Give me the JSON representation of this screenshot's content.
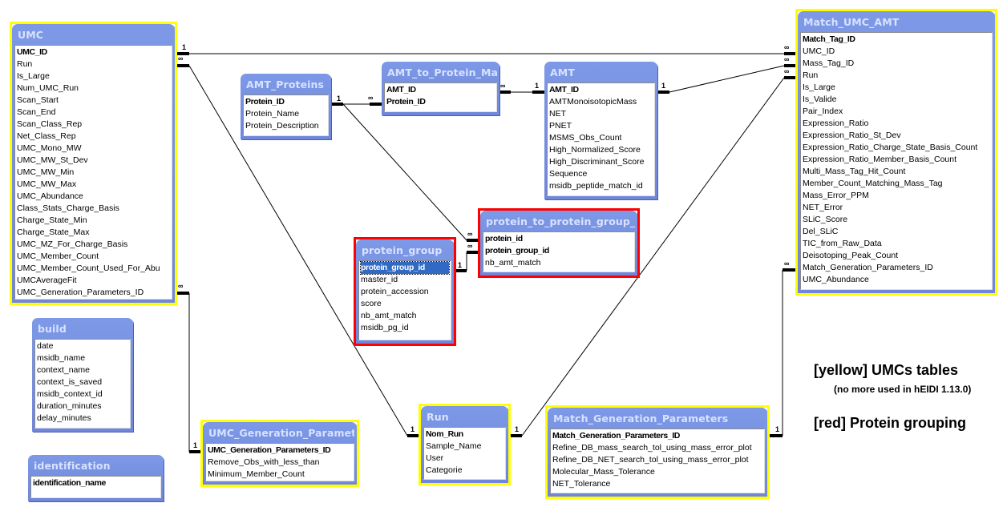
{
  "tables": {
    "umc": {
      "title": "UMC",
      "highlight": "yellow",
      "fields": [
        {
          "name": "UMC_ID",
          "pk": true
        },
        {
          "name": "Run"
        },
        {
          "name": "Is_Large"
        },
        {
          "name": "Num_UMC_Run"
        },
        {
          "name": "Scan_Start"
        },
        {
          "name": "Scan_End"
        },
        {
          "name": "Scan_Class_Rep"
        },
        {
          "name": "Net_Class_Rep"
        },
        {
          "name": "UMC_Mono_MW"
        },
        {
          "name": "UMC_MW_St_Dev"
        },
        {
          "name": "UMC_MW_Min"
        },
        {
          "name": "UMC_MW_Max"
        },
        {
          "name": "UMC_Abundance"
        },
        {
          "name": "Class_Stats_Charge_Basis"
        },
        {
          "name": "Charge_State_Min"
        },
        {
          "name": "Charge_State_Max"
        },
        {
          "name": "UMC_MZ_For_Charge_Basis"
        },
        {
          "name": "UMC_Member_Count"
        },
        {
          "name": "UMC_Member_Count_Used_For_Abu"
        },
        {
          "name": "UMCAverageFit"
        },
        {
          "name": "UMC_Generation_Parameters_ID"
        }
      ]
    },
    "build": {
      "title": "build",
      "highlight": "none",
      "fields": [
        {
          "name": "date"
        },
        {
          "name": "msidb_name"
        },
        {
          "name": "context_name"
        },
        {
          "name": "context_is_saved"
        },
        {
          "name": "msidb_context_id"
        },
        {
          "name": "duration_minutes"
        },
        {
          "name": "delay_minutes"
        }
      ]
    },
    "identification": {
      "title": "identification",
      "highlight": "none",
      "fields": [
        {
          "name": "identification_name",
          "pk": true
        }
      ]
    },
    "amt_proteins": {
      "title": "AMT_Proteins",
      "highlight": "none",
      "fields": [
        {
          "name": "Protein_ID",
          "pk": true
        },
        {
          "name": "Protein_Name"
        },
        {
          "name": "Protein_Description"
        }
      ]
    },
    "amt_to_protein_map": {
      "title": "AMT_to_Protein_Map",
      "highlight": "none",
      "fields": [
        {
          "name": "AMT_ID",
          "pk": true
        },
        {
          "name": "Protein_ID",
          "pk": true
        }
      ]
    },
    "amt": {
      "title": "AMT",
      "highlight": "none",
      "fields": [
        {
          "name": "AMT_ID",
          "pk": true
        },
        {
          "name": "AMTMonoisotopicMass"
        },
        {
          "name": "NET"
        },
        {
          "name": "PNET"
        },
        {
          "name": "MSMS_Obs_Count"
        },
        {
          "name": "High_Normalized_Score"
        },
        {
          "name": "High_Discriminant_Score"
        },
        {
          "name": "Sequence"
        },
        {
          "name": "msidb_peptide_match_id"
        }
      ]
    },
    "protein_to_protein_group": {
      "title": "protein_to_protein_group_...",
      "highlight": "red",
      "fields": [
        {
          "name": "protein_id",
          "pk": true
        },
        {
          "name": "protein_group_id",
          "pk": true
        },
        {
          "name": "nb_amt_match"
        }
      ]
    },
    "protein_group": {
      "title": "protein_group",
      "highlight": "red",
      "fields": [
        {
          "name": "protein_group_id",
          "pk": true,
          "selected": true
        },
        {
          "name": "master_id"
        },
        {
          "name": "protein_accession"
        },
        {
          "name": "score"
        },
        {
          "name": "nb_amt_match"
        },
        {
          "name": "msidb_pg_id"
        }
      ]
    },
    "match_umc_amt": {
      "title": "Match_UMC_AMT",
      "highlight": "yellow",
      "fields": [
        {
          "name": "Match_Tag_ID",
          "pk": true
        },
        {
          "name": "UMC_ID"
        },
        {
          "name": "Mass_Tag_ID"
        },
        {
          "name": "Run"
        },
        {
          "name": "Is_Large"
        },
        {
          "name": "Is_Valide"
        },
        {
          "name": "Pair_Index"
        },
        {
          "name": "Expression_Ratio"
        },
        {
          "name": "Expression_Ratio_St_Dev"
        },
        {
          "name": "Expression_Ratio_Charge_State_Basis_Count"
        },
        {
          "name": "Expression_Ratio_Member_Basis_Count"
        },
        {
          "name": "Multi_Mass_Tag_Hit_Count"
        },
        {
          "name": "Member_Count_Matching_Mass_Tag"
        },
        {
          "name": "Mass_Error_PPM"
        },
        {
          "name": "NET_Error"
        },
        {
          "name": "SLiC_Score"
        },
        {
          "name": "Del_SLiC"
        },
        {
          "name": "TIC_from_Raw_Data"
        },
        {
          "name": "Deisotoping_Peak_Count"
        },
        {
          "name": "Match_Generation_Parameters_ID"
        },
        {
          "name": "UMC_Abundance"
        }
      ]
    },
    "umc_generation_parameters": {
      "title": "UMC_Generation_Parameters",
      "highlight": "yellow",
      "fields": [
        {
          "name": "UMC_Generation_Parameters_ID",
          "pk": true
        },
        {
          "name": "Remove_Obs_with_less_than"
        },
        {
          "name": "Minimum_Member_Count"
        }
      ]
    },
    "run": {
      "title": "Run",
      "highlight": "yellow",
      "fields": [
        {
          "name": "Nom_Run",
          "pk": true
        },
        {
          "name": "Sample_Name"
        },
        {
          "name": "User"
        },
        {
          "name": "Categorie"
        }
      ]
    },
    "match_generation_parameters": {
      "title": "Match_Generation_Parameters",
      "highlight": "yellow",
      "fields": [
        {
          "name": "Match_Generation_Parameters_ID",
          "pk": true
        },
        {
          "name": "Refine_DB_mass_search_tol_using_mass_error_plot"
        },
        {
          "name": "Refine_DB_NET_search_tol_using_mass_error_plot"
        },
        {
          "name": "Molecular_Mass_Tolerance"
        },
        {
          "name": "NET_Tolerance"
        }
      ]
    }
  },
  "relationships": [
    {
      "from": "UMC.UMC_ID",
      "from_card": "1",
      "to": "Match_UMC_AMT.UMC_ID",
      "to_card": "∞"
    },
    {
      "from": "UMC.Run",
      "from_card": "∞",
      "to": "Run.Nom_Run",
      "to_card": "1"
    },
    {
      "from": "UMC.UMC_Generation_Parameters_ID",
      "from_card": "∞",
      "to": "UMC_Generation_Parameters.UMC_Generation_Parameters_ID",
      "to_card": "1"
    },
    {
      "from": "AMT_Proteins.Protein_ID",
      "from_card": "1",
      "to": "AMT_to_Protein_Map.Protein_ID",
      "to_card": "∞"
    },
    {
      "from": "AMT_Proteins.Protein_ID",
      "from_card": "1",
      "to": "protein_to_protein_group.protein_id",
      "to_card": "∞"
    },
    {
      "from": "AMT_to_Protein_Map.AMT_ID",
      "from_card": "∞",
      "to": "AMT.AMT_ID",
      "to_card": "1"
    },
    {
      "from": "AMT.AMT_ID",
      "from_card": "1",
      "to": "Match_UMC_AMT.Mass_Tag_ID",
      "to_card": "∞"
    },
    {
      "from": "protein_group.protein_group_id",
      "from_card": "1",
      "to": "protein_to_protein_group.protein_group_id",
      "to_card": "∞"
    },
    {
      "from": "Run.Nom_Run",
      "from_card": "1",
      "to": "Match_UMC_AMT.Run",
      "to_card": "∞"
    },
    {
      "from": "Match_Generation_Parameters.Match_Generation_Parameters_ID",
      "from_card": "1",
      "to": "Match_UMC_AMT.Match_Generation_Parameters_ID",
      "to_card": "∞"
    }
  ],
  "legend": {
    "yellow_label": "[yellow] UMCs tables",
    "yellow_note": "(no more used in hEIDI 1.13.0)",
    "red_label": "[red] Protein grouping"
  },
  "colors": {
    "title_bar": "#7390e2",
    "title_text": "#d8e2ff",
    "highlight_yellow": "#ffff00",
    "highlight_red": "#ff0000",
    "selection": "#316ac5"
  }
}
